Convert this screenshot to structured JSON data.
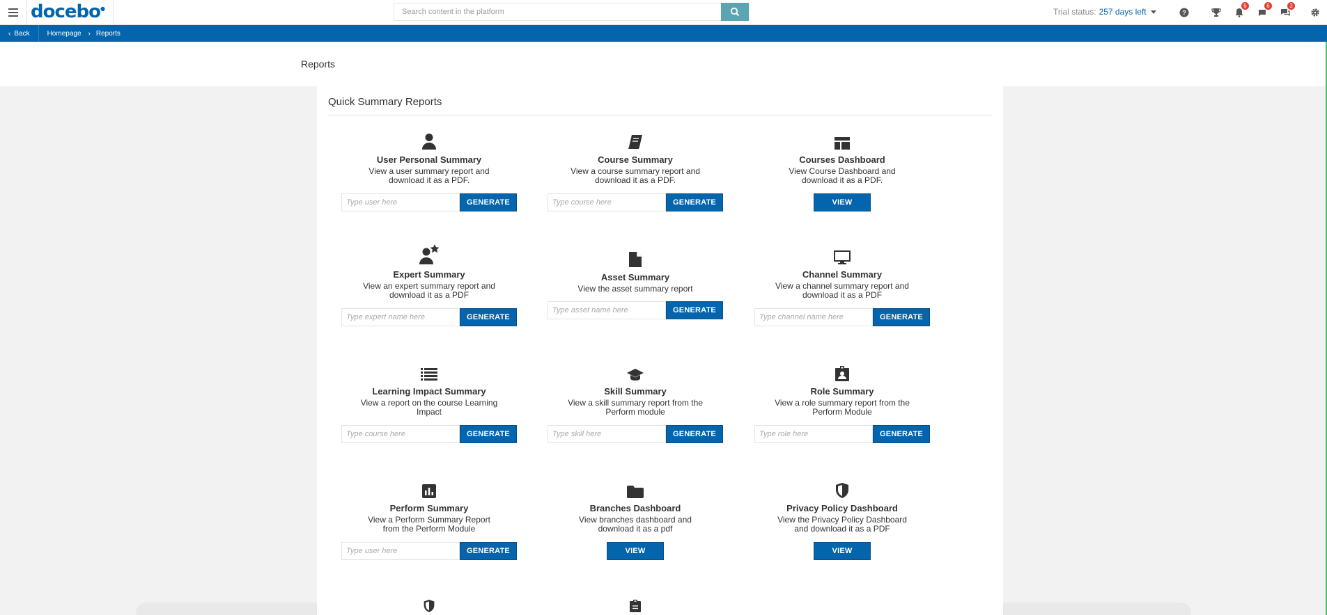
{
  "header": {
    "logo": "docebo",
    "search_placeholder": "Search content in the platform",
    "trial_label": "Trial status:",
    "trial_days": "257 days left",
    "badges": {
      "notifications": "6",
      "messages": "6",
      "chat": "3"
    }
  },
  "breadcrumb": {
    "back": "Back",
    "items": [
      "Homepage",
      "Reports"
    ]
  },
  "page": {
    "title": "Reports",
    "section_title": "Quick Summary Reports"
  },
  "tiles": [
    {
      "title": "User Personal Summary",
      "desc": "View a user summary report and download it as a PDF.",
      "placeholder": "Type user here",
      "button": "GENERATE"
    },
    {
      "title": "Course Summary",
      "desc": "View a course summary report and download it as a PDF.",
      "placeholder": "Type course here",
      "button": "GENERATE"
    },
    {
      "title": "Courses Dashboard",
      "desc": "View Course Dashboard and download it as a PDF.",
      "button": "VIEW"
    },
    {
      "title": "Expert Summary",
      "desc": "View an expert summary report and download it as a PDF",
      "placeholder": "Type expert name here",
      "button": "GENERATE"
    },
    {
      "title": "Asset Summary",
      "desc": "View the asset summary report",
      "placeholder": "Type asset name here",
      "button": "GENERATE"
    },
    {
      "title": "Channel Summary",
      "desc": "View a channel summary report and download it as a PDF",
      "placeholder": "Type channel name here",
      "button": "GENERATE"
    },
    {
      "title": "Learning Impact Summary",
      "desc": "View a report on the course Learning Impact",
      "placeholder": "Type course here",
      "button": "GENERATE"
    },
    {
      "title": "Skill Summary",
      "desc": "View a skill summary report from the Perform module",
      "placeholder": "Type skill here",
      "button": "GENERATE"
    },
    {
      "title": "Role Summary",
      "desc": "View a role summary report from the Perform Module",
      "placeholder": "Type role here",
      "button": "GENERATE"
    },
    {
      "title": "Perform Summary",
      "desc": "View a Perform Summary Report from the Perform Module",
      "placeholder": "Type user here",
      "button": "GENERATE"
    },
    {
      "title": "Branches Dashboard",
      "desc": "View branches dashboard and download it as a pdf",
      "button": "VIEW"
    },
    {
      "title": "Privacy Policy Dashboard",
      "desc": "View the Privacy Policy Dashboard and download it as a PDF",
      "button": "VIEW"
    }
  ]
}
